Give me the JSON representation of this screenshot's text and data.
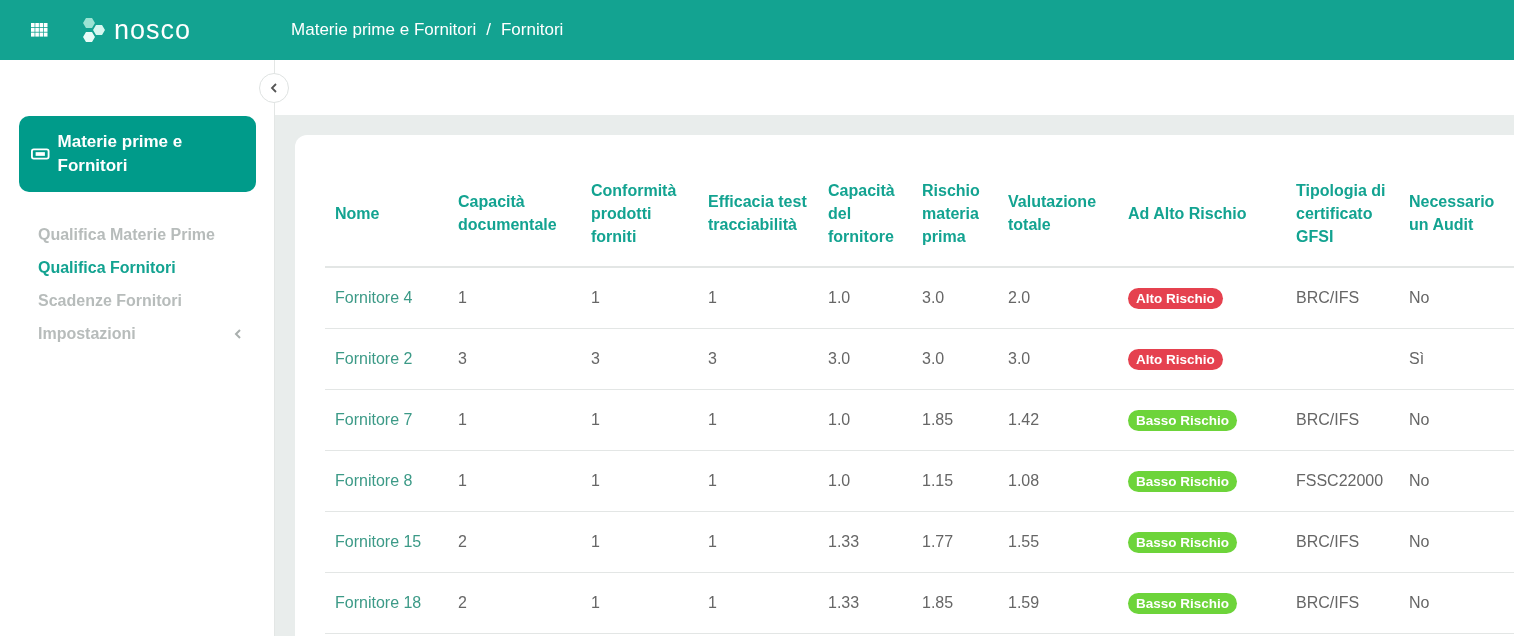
{
  "header": {
    "logo_text": "nosco",
    "breadcrumb": [
      "Materie prime e Fornitori",
      "Fornitori"
    ],
    "breadcrumb_separator": "/"
  },
  "sidebar": {
    "section": {
      "label": "Materie prime e Fornitori",
      "selected": true
    },
    "items": [
      {
        "label": "Qualifica Materie Prime",
        "selected": false
      },
      {
        "label": "Qualifica Fornitori",
        "selected": true
      },
      {
        "label": "Scadenze Fornitori",
        "selected": false
      },
      {
        "label": "Impostazioni",
        "selected": false,
        "expanded": false
      }
    ]
  },
  "table": {
    "columns": [
      "Nome",
      "Capacità documentale",
      "Conformità prodotti forniti",
      "Efficacia test tracciabilità",
      "Capacità del fornitore",
      "Rischio materia prima",
      "Valutazione totale",
      "Ad Alto Rischio",
      "Tipologia di certificato GFSI",
      "Necessario un Audit"
    ],
    "rows": [
      {
        "cells": [
          "Fornitore 4",
          "1",
          "1",
          "1",
          "1.0",
          "3.0",
          "2.0",
          {
            "kind": "badge",
            "label": "Alto Rischio",
            "color": "#e5414f"
          },
          "BRC/IFS",
          "No"
        ]
      },
      {
        "cells": [
          "Fornitore 2",
          "3",
          "3",
          "3",
          "3.0",
          "3.0",
          "3.0",
          {
            "kind": "badge",
            "label": "Alto Rischio",
            "color": "#e5414f"
          },
          null,
          "Sì"
        ]
      },
      {
        "cells": [
          "Fornitore 7",
          "1",
          "1",
          "1",
          "1.0",
          "1.85",
          "1.42",
          {
            "kind": "badge",
            "label": "Basso Rischio",
            "color": "#6dd43a"
          },
          "BRC/IFS",
          "No"
        ]
      },
      {
        "cells": [
          "Fornitore 8",
          "1",
          "1",
          "1",
          "1.0",
          "1.15",
          "1.08",
          {
            "kind": "badge",
            "label": "Basso Rischio",
            "color": "#6dd43a"
          },
          "FSSC22000",
          "No"
        ]
      },
      {
        "cells": [
          "Fornitore 15",
          "2",
          "1",
          "1",
          "1.33",
          "1.77",
          "1.55",
          {
            "kind": "badge",
            "label": "Basso Rischio",
            "color": "#6dd43a"
          },
          "BRC/IFS",
          "No"
        ]
      },
      {
        "cells": [
          "Fornitore 18",
          "2",
          "1",
          "1",
          "1.33",
          "1.85",
          "1.59",
          {
            "kind": "badge",
            "label": "Basso Rischio",
            "color": "#6dd43a"
          },
          "BRC/IFS",
          "No"
        ]
      }
    ]
  }
}
